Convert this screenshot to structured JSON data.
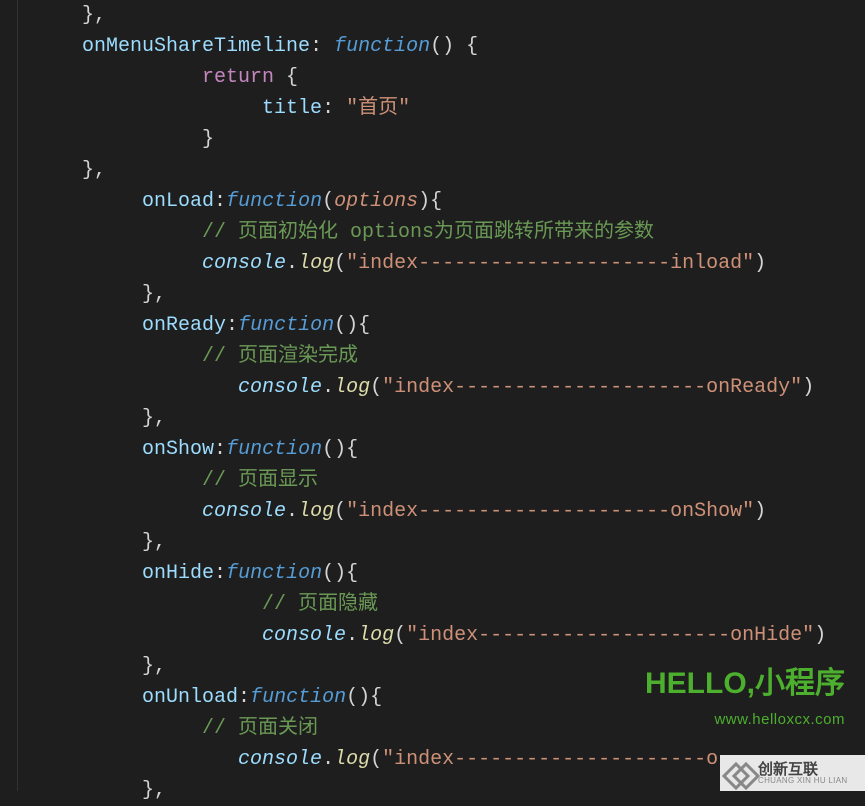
{
  "lines": [
    {
      "indent": 1,
      "parts": [
        {
          "cls": "tok-brace",
          "t": "},"
        }
      ]
    },
    {
      "indent": 1,
      "parts": [
        {
          "cls": "tok-key",
          "t": "onMenuShareTimeline"
        },
        {
          "cls": "tok-punct",
          "t": ": "
        },
        {
          "cls": "tok-func",
          "t": "function"
        },
        {
          "cls": "tok-punct",
          "t": "() "
        },
        {
          "cls": "tok-brace",
          "t": "{"
        }
      ]
    },
    {
      "indent": 3,
      "parts": [
        {
          "cls": "tok-return",
          "t": "return "
        },
        {
          "cls": "tok-brace",
          "t": "{"
        }
      ]
    },
    {
      "indent": 4,
      "parts": [
        {
          "cls": "tok-key",
          "t": "title"
        },
        {
          "cls": "tok-punct",
          "t": ": "
        },
        {
          "cls": "tok-str",
          "t": "\"首页\""
        }
      ]
    },
    {
      "indent": 3,
      "parts": [
        {
          "cls": "tok-brace",
          "t": "}"
        }
      ]
    },
    {
      "indent": 1,
      "parts": [
        {
          "cls": "tok-brace",
          "t": "},"
        }
      ]
    },
    {
      "indent": 2,
      "parts": [
        {
          "cls": "tok-key",
          "t": "onLoad"
        },
        {
          "cls": "tok-punct",
          "t": ":"
        },
        {
          "cls": "tok-func",
          "t": "function"
        },
        {
          "cls": "tok-punct",
          "t": "("
        },
        {
          "cls": "tok-param",
          "t": "options"
        },
        {
          "cls": "tok-punct",
          "t": ")"
        },
        {
          "cls": "tok-brace",
          "t": "{"
        }
      ]
    },
    {
      "indent": 3,
      "parts": [
        {
          "cls": "tok-comment",
          "t": "// 页面初始化 options为页面跳转所带来的参数"
        }
      ]
    },
    {
      "indent": 3,
      "parts": [
        {
          "cls": "tok-console",
          "t": "console"
        },
        {
          "cls": "tok-dot",
          "t": "."
        },
        {
          "cls": "tok-log",
          "t": "log"
        },
        {
          "cls": "tok-punct",
          "t": "("
        },
        {
          "cls": "tok-str",
          "t": "\"index---------------------inload\""
        },
        {
          "cls": "tok-punct",
          "t": ")"
        }
      ]
    },
    {
      "indent": 2,
      "parts": [
        {
          "cls": "tok-brace",
          "t": "},"
        }
      ]
    },
    {
      "indent": 2,
      "parts": [
        {
          "cls": "tok-key",
          "t": "onReady"
        },
        {
          "cls": "tok-punct",
          "t": ":"
        },
        {
          "cls": "tok-func",
          "t": "function"
        },
        {
          "cls": "tok-punct",
          "t": "()"
        },
        {
          "cls": "tok-brace",
          "t": "{"
        }
      ]
    },
    {
      "indent": 3,
      "parts": [
        {
          "cls": "tok-comment",
          "t": "// 页面渲染完成"
        }
      ]
    },
    {
      "indent": 3.5,
      "parts": [
        {
          "cls": "tok-console",
          "t": "console"
        },
        {
          "cls": "tok-dot",
          "t": "."
        },
        {
          "cls": "tok-log",
          "t": "log"
        },
        {
          "cls": "tok-punct",
          "t": "("
        },
        {
          "cls": "tok-str",
          "t": "\"index---------------------onReady\""
        },
        {
          "cls": "tok-punct",
          "t": ")"
        }
      ]
    },
    {
      "indent": 2,
      "parts": [
        {
          "cls": "tok-brace",
          "t": "},"
        }
      ]
    },
    {
      "indent": 2,
      "parts": [
        {
          "cls": "tok-key",
          "t": "onShow"
        },
        {
          "cls": "tok-punct",
          "t": ":"
        },
        {
          "cls": "tok-func",
          "t": "function"
        },
        {
          "cls": "tok-punct",
          "t": "()"
        },
        {
          "cls": "tok-brace",
          "t": "{"
        }
      ]
    },
    {
      "indent": 3,
      "parts": [
        {
          "cls": "tok-comment",
          "t": "// 页面显示"
        }
      ]
    },
    {
      "indent": 3,
      "parts": [
        {
          "cls": "tok-console",
          "t": "console"
        },
        {
          "cls": "tok-dot",
          "t": "."
        },
        {
          "cls": "tok-log",
          "t": "log"
        },
        {
          "cls": "tok-punct",
          "t": "("
        },
        {
          "cls": "tok-str",
          "t": "\"index---------------------onShow\""
        },
        {
          "cls": "tok-punct",
          "t": ")"
        }
      ]
    },
    {
      "indent": 2,
      "parts": [
        {
          "cls": "tok-brace",
          "t": "},"
        }
      ]
    },
    {
      "indent": 2,
      "parts": [
        {
          "cls": "tok-key",
          "t": "onHide"
        },
        {
          "cls": "tok-punct",
          "t": ":"
        },
        {
          "cls": "tok-func",
          "t": "function"
        },
        {
          "cls": "tok-punct",
          "t": "()"
        },
        {
          "cls": "tok-brace",
          "t": "{"
        }
      ]
    },
    {
      "indent": 4,
      "parts": [
        {
          "cls": "tok-comment",
          "t": "// 页面隐藏"
        }
      ]
    },
    {
      "indent": 4,
      "parts": [
        {
          "cls": "tok-console",
          "t": "console"
        },
        {
          "cls": "tok-dot",
          "t": "."
        },
        {
          "cls": "tok-log",
          "t": "log"
        },
        {
          "cls": "tok-punct",
          "t": "("
        },
        {
          "cls": "tok-str",
          "t": "\"index---------------------onHide\""
        },
        {
          "cls": "tok-punct",
          "t": ")"
        }
      ]
    },
    {
      "indent": 2,
      "parts": [
        {
          "cls": "tok-brace",
          "t": "},"
        }
      ]
    },
    {
      "indent": 2,
      "parts": [
        {
          "cls": "tok-key",
          "t": "onUnload"
        },
        {
          "cls": "tok-punct",
          "t": ":"
        },
        {
          "cls": "tok-func",
          "t": "function"
        },
        {
          "cls": "tok-punct",
          "t": "()"
        },
        {
          "cls": "tok-brace",
          "t": "{"
        }
      ]
    },
    {
      "indent": 3,
      "parts": [
        {
          "cls": "tok-comment",
          "t": "// 页面关闭"
        }
      ]
    },
    {
      "indent": 3.5,
      "parts": [
        {
          "cls": "tok-console",
          "t": "console"
        },
        {
          "cls": "tok-dot",
          "t": "."
        },
        {
          "cls": "tok-log",
          "t": "log"
        },
        {
          "cls": "tok-punct",
          "t": "("
        },
        {
          "cls": "tok-str",
          "t": "\"index---------------------o"
        }
      ]
    },
    {
      "indent": 2,
      "parts": [
        {
          "cls": "tok-brace",
          "t": "},"
        }
      ]
    }
  ],
  "watermark": {
    "title": "HELLO,小程序",
    "url": "www.helloxcx.com"
  },
  "footer": {
    "cn": "创新互联",
    "en": "CHUANG XIN HU LIAN"
  }
}
